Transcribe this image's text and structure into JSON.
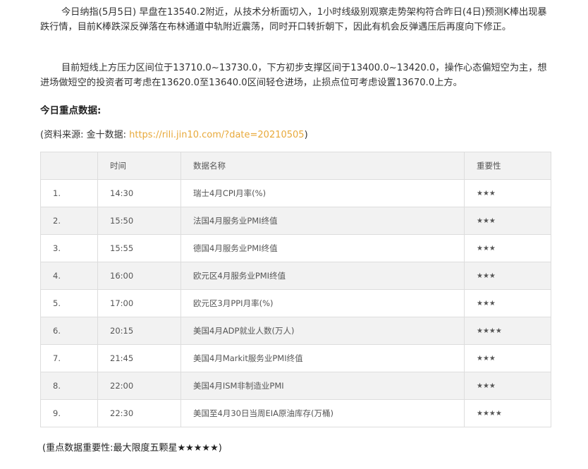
{
  "paragraphs": [
    "今日纳指(5月5日) 早盘在13540.2附近，从技术分析面切入，1小时线级别观察走势架构符合昨日(4日)预测K棒出现暴跌行情，目前K棒跌深反弹落在布林通道中轨附近震荡，同时开口转折朝下，因此有机会反弹遇压后再度向下修正。",
    "目前短线上方压力区间位于13710.0~13730.0，下方初步支撑区间于13400.0~13420.0，操作心态偏短空为主，想进场做短空的投资者可考虑在13620.0至13640.0区间轻仓进场，止损点位可考虑设置13670.0上方。"
  ],
  "heading": "今日重点数据:",
  "source": {
    "prefix": "(资料来源: 金十数据: ",
    "link": "https://rili.jin10.com/?date=20210505",
    "suffix": ")"
  },
  "table": {
    "headers": [
      "",
      "时间",
      "数据名称",
      "重要性"
    ],
    "rows": [
      {
        "no": "1.",
        "time": "14:30",
        "name": "瑞士4月CPI月率(%)",
        "importance": "★★★"
      },
      {
        "no": "2.",
        "time": "15:50",
        "name": "法国4月服务业PMI终值",
        "importance": "★★★"
      },
      {
        "no": "3.",
        "time": "15:55",
        "name": "德国4月服务业PMI终值",
        "importance": "★★★"
      },
      {
        "no": "4.",
        "time": "16:00",
        "name": "欧元区4月服务业PMI终值",
        "importance": "★★★"
      },
      {
        "no": "5.",
        "time": "17:00",
        "name": "欧元区3月PPI月率(%)",
        "importance": "★★★"
      },
      {
        "no": "6.",
        "time": "20:15",
        "name": "美国4月ADP就业人数(万人)",
        "importance": "★★★★"
      },
      {
        "no": "7.",
        "time": "21:45",
        "name": "美国4月Markit服务业PMI终值",
        "importance": "★★★"
      },
      {
        "no": "8.",
        "time": "22:00",
        "name": "美国4月ISM非制造业PMI",
        "importance": "★★★"
      },
      {
        "no": "9.",
        "time": "22:30",
        "name": "美国至4月30日当周EIA原油库存(万桶)",
        "importance": "★★★★"
      }
    ]
  },
  "note": "(重点数据重要性:最大限度五颗星★★★★★)",
  "colors": {
    "link": "#e8a93a",
    "text": "#333333",
    "table_stripe": "#f2f2f2",
    "table_border": "#dddddd"
  }
}
